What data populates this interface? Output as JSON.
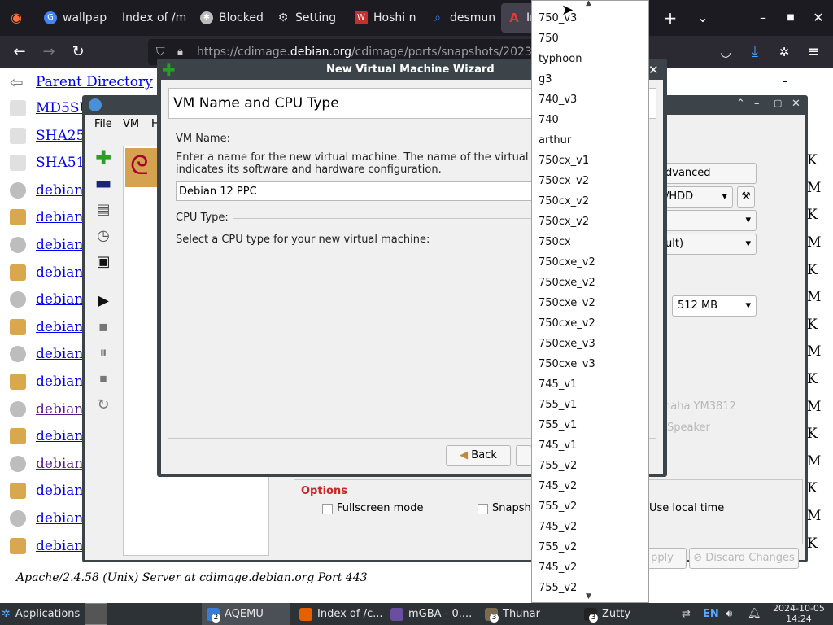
{
  "browser": {
    "tabs": [
      {
        "label": "wallpap",
        "icon": "google-icon",
        "color": "#4285f4"
      },
      {
        "label": "Index of /m",
        "icon": "",
        "color": ""
      },
      {
        "label": "Blocked",
        "icon": "puzzle-icon",
        "color": "#bbbbbb"
      },
      {
        "label": "Setting",
        "icon": "gear-icon",
        "color": "#cccccc"
      },
      {
        "label": "Hoshi n",
        "icon": "w-icon",
        "color": "#c4302b"
      },
      {
        "label": "desmun",
        "icon": "search-icon",
        "color": "#3b82f6"
      },
      {
        "label": "In",
        "icon": "a-icon",
        "color": "#d32f2f"
      }
    ],
    "url_prefix": "https://cdimage.",
    "url_domain": "debian.org",
    "url_rest": "/cdimage/ports/snapshots/2023"
  },
  "listing": {
    "parent": "Parent Directory",
    "parent_size": "-",
    "rows": [
      {
        "name": "MD5SU",
        "size": "",
        "icon": "text-file-icon"
      },
      {
        "name": "SHA25",
        "size": "",
        "icon": "text-file-icon"
      },
      {
        "name": "SHA51",
        "size": "K",
        "icon": "text-file-icon"
      },
      {
        "name": "debian",
        "size": "M",
        "icon": "disc-icon"
      },
      {
        "name": "debian",
        "size": "K",
        "icon": "package-icon"
      },
      {
        "name": "debian",
        "size": "M",
        "icon": "disc-icon"
      },
      {
        "name": "debian",
        "size": "K",
        "icon": "package-icon"
      },
      {
        "name": "debian",
        "size": "M",
        "icon": "disc-icon"
      },
      {
        "name": "debian",
        "size": "K",
        "icon": "package-icon"
      },
      {
        "name": "debian",
        "size": "M",
        "icon": "disc-icon"
      },
      {
        "name": "debian",
        "size": "K",
        "icon": "package-icon"
      },
      {
        "name": "debian",
        "size": "M",
        "icon": "disc-icon",
        "visited": true
      },
      {
        "name": "debian",
        "size": "K",
        "icon": "package-icon"
      },
      {
        "name": "debian",
        "size": "M",
        "icon": "disc-icon",
        "visited": true
      },
      {
        "name": "debian",
        "size": "K",
        "icon": "package-icon"
      },
      {
        "name": "debian",
        "size": "M",
        "icon": "disc-icon"
      },
      {
        "name": "debian",
        "size": "K",
        "icon": "package-icon"
      }
    ],
    "footer": "Apache/2.4.58 (Unix) Server at cdimage.debian.org Port 443"
  },
  "aqemu": {
    "menu": [
      "File",
      "VM",
      "H"
    ],
    "advanced_label": "dvanced",
    "hdd_label": "/HDD",
    "default_label": "ult)",
    "memory": "512 MB",
    "sound_1": "naha YM3812",
    "sound_2": "Speaker",
    "options_title": "Options",
    "fullscreen": "Fullscreen mode",
    "snapshot": "Snapsh",
    "localtime": "Use local time",
    "apply": "pply",
    "discard": "Discard Changes"
  },
  "wizard": {
    "title": "New Virtual Machine Wizard",
    "page_title": "VM Name and CPU Type",
    "vm_name_label": "VM Name:",
    "vm_name_desc1": "Enter a name for the new virtual machine. The name of the virtual",
    "vm_name_desc2": "indicates its software and hardware configuration.",
    "vm_name_value": "Debian 12 PPC",
    "cpu_type_label": "CPU Type:",
    "cpu_desc": "Select a CPU type for your new virtual machine:",
    "back": "Back"
  },
  "cpu_options": [
    "750_v3",
    "750",
    "typhoon",
    "g3",
    "740_v3",
    "740",
    "arthur",
    "750cx_v1",
    "750cx_v2",
    "750cx_v2",
    "750cx_v2",
    "750cx",
    "750cxe_v2",
    "750cxe_v2",
    "750cxe_v2",
    "750cxe_v2",
    "750cxe_v3",
    "750cxe_v3",
    "745_v1",
    "755_v1",
    "755_v1",
    "745_v1",
    "755_v2",
    "745_v2",
    "755_v2",
    "745_v2",
    "755_v2",
    "745_v2",
    "755_v2"
  ],
  "taskbar": {
    "applications": "Applications",
    "items": [
      {
        "label": "AQEMU",
        "badge": "2",
        "color": "#3a7bd5"
      },
      {
        "label": "Index of /c...",
        "badge": "",
        "color": "#e66000"
      },
      {
        "label": "mGBA - 0....",
        "badge": "",
        "color": "#6a4fa0"
      },
      {
        "label": "Thunar",
        "badge": "3",
        "color": "#7a6a50"
      },
      {
        "label": "Zutty",
        "badge": "3",
        "color": "#222222"
      }
    ],
    "lang": "EN",
    "date": "2024-10-05",
    "time": "14:24"
  }
}
